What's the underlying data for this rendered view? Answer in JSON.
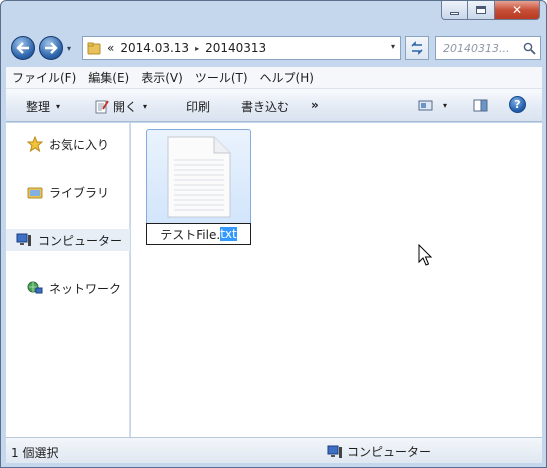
{
  "window": {
    "caption_buttons": [
      "minimize-icon",
      "maximize-icon",
      "close-icon"
    ],
    "close_glyph": "✕"
  },
  "address_bar": {
    "overflow_glyph": "«",
    "crumbs": [
      "2014.03.13",
      "20140313"
    ],
    "separator_glyph": "▸",
    "dropdown_glyph": "▾"
  },
  "search": {
    "placeholder": "20140313..."
  },
  "menu": {
    "items": [
      "ファイル(F)",
      "編集(E)",
      "表示(V)",
      "ツール(T)",
      "ヘルプ(H)"
    ]
  },
  "command_bar": {
    "organize": "整理",
    "open": "開く",
    "print": "印刷",
    "write": "書き込む",
    "more": "»",
    "dropdown_glyph": "▾",
    "help": "?"
  },
  "nav_pane": {
    "items": [
      {
        "label": "お気に入り",
        "icon": "star-icon"
      },
      {
        "label": "ライブラリ",
        "icon": "library-icon"
      },
      {
        "label": "コンピューター",
        "icon": "computer-icon"
      },
      {
        "label": "ネットワーク",
        "icon": "network-icon"
      }
    ]
  },
  "content": {
    "file": {
      "name_prefix": "テストFile.",
      "name_selected": "txt",
      "icon": "text-file-icon"
    }
  },
  "status_bar": {
    "selection": "1 個選択",
    "location": "コンピューター"
  },
  "colors": {
    "frame": "#c5d7ec",
    "selection": "#3399ff",
    "tile_border": "#84acdd"
  }
}
